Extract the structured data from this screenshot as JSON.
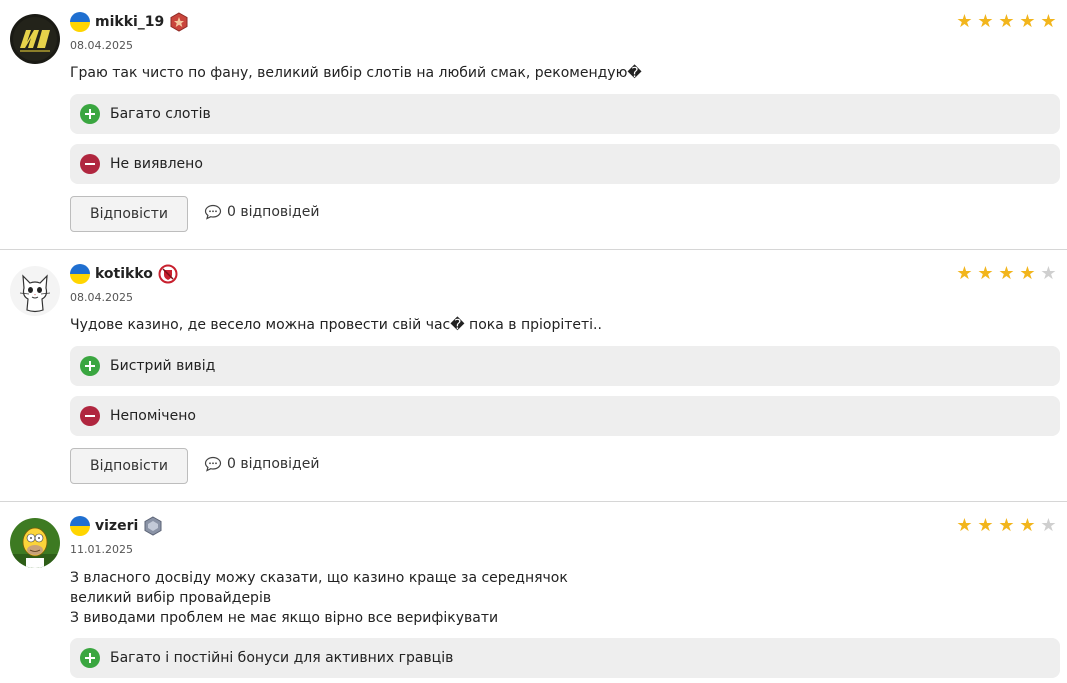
{
  "reply_label": "Відповісти",
  "colors": {
    "star_on": "#f2b51c",
    "star_off": "#cfcfcf",
    "plus": "#3aa640",
    "minus": "#b0263f",
    "pill_bg": "#eeeeee"
  },
  "reviews": [
    {
      "username": "mikki_19",
      "country_flag": "ukraine-flag-icon",
      "badge": "red-rank-badge-icon",
      "avatar": "navi-logo-avatar",
      "date": "08.04.2025",
      "rating": 5,
      "text": [
        "Граю так чисто по фану, великий вибір слотів на любий смак, рекомендую�"
      ],
      "pros": [
        "Багато слотів"
      ],
      "cons": [
        "Не виявлено"
      ],
      "replies_count": "0 відповідей"
    },
    {
      "username": "kotikko",
      "country_flag": "ukraine-flag-icon",
      "badge": "red-shield-badge-icon",
      "avatar": "cat-drawing-avatar",
      "date": "08.04.2025",
      "rating": 4,
      "text": [
        "Чудове казино, де весело можна провести свій час� пока в пріорітеті.."
      ],
      "pros": [
        "Бистрий вивід"
      ],
      "cons": [
        "Непомічено"
      ],
      "replies_count": "0 відповідей"
    },
    {
      "username": "vizeri",
      "country_flag": "ukraine-flag-icon",
      "badge": "silver-rank-badge-icon",
      "avatar": "homer-simpson-avatar",
      "date": "11.01.2025",
      "rating": 4,
      "text": [
        "З власного досвіду можу сказати, що казино краще за середнячок",
        "великий вибір провайдерів",
        "З виводами проблем не має якщо вірно все верифікувати"
      ],
      "pros": [
        "Багато і постійні бонуси для активних гравців"
      ],
      "cons": [],
      "replies_count": ""
    }
  ]
}
